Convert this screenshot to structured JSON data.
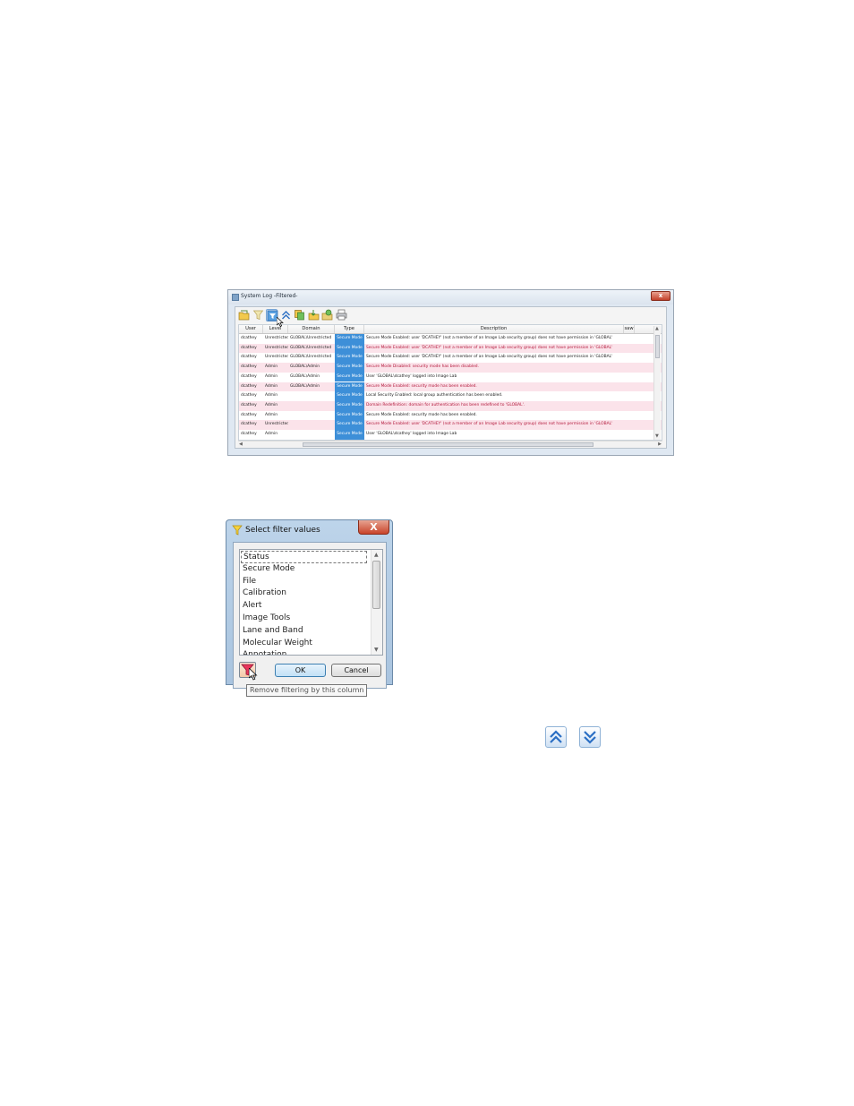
{
  "system_log": {
    "title": "System Log -Filtered-",
    "close_label": "x",
    "toolbar": [
      {
        "icon": "open-folder-icon"
      },
      {
        "icon": "filter-icon"
      },
      {
        "icon": "filtered-view-icon",
        "active": true
      },
      {
        "icon": "collapse-all-icon"
      },
      {
        "icon": "copy-icon"
      },
      {
        "icon": "export-icon"
      },
      {
        "icon": "refresh-icon"
      },
      {
        "icon": "print-icon"
      }
    ],
    "columns": [
      "User",
      "Level",
      "Domain",
      "Type",
      "Description",
      "saw"
    ],
    "rows": [
      {
        "user": "dcathey",
        "level": "Unrestricted",
        "domain": "GLOBAL\\Unrestricted",
        "type": "Secure Mode",
        "description": "Secure Mode Enabled: user 'DCATHEY' (not a member of an Image Lab security group) does not have permission in 'GLOBAL'",
        "pink": false,
        "red": false
      },
      {
        "user": "dcathey",
        "level": "Unrestricted",
        "domain": "GLOBAL\\Unrestricted",
        "type": "Secure Mode",
        "description": "Secure Mode Enabled: user 'DCATHEY' (not a member of an Image Lab security group) does not have permission in 'GLOBAL'",
        "pink": true,
        "red": true
      },
      {
        "user": "dcathey",
        "level": "Unrestricted",
        "domain": "GLOBAL\\Unrestricted",
        "type": "Secure Mode",
        "description": "Secure Mode Enabled: user 'DCATHEY' (not a member of an Image Lab security group) does not have permission in 'GLOBAL'",
        "pink": false,
        "red": false
      },
      {
        "user": "dcathey",
        "level": "Admin",
        "domain": "GLOBAL\\Admin",
        "type": "Secure Mode",
        "description": "Secure Mode Disabled: security mode has been disabled.",
        "pink": true,
        "red": true
      },
      {
        "user": "dcathey",
        "level": "Admin",
        "domain": "GLOBAL\\Admin",
        "type": "Secure Mode",
        "description": "User 'GLOBAL\\dcathey' logged into Image Lab",
        "pink": false,
        "red": false
      },
      {
        "user": "dcathey",
        "level": "Admin",
        "domain": "GLOBAL\\Admin",
        "type": "Secure Mode",
        "description": "Secure Mode Enabled: security mode has been enabled.",
        "pink": true,
        "red": true
      },
      {
        "user": "dcathey",
        "level": "Admin",
        "domain": "",
        "type": "Secure Mode",
        "description": "Local Security Enabled: local group authentication has been enabled.",
        "pink": false,
        "red": false
      },
      {
        "user": "dcathey",
        "level": "Admin",
        "domain": "",
        "type": "Secure Mode",
        "description": "Domain Redefinition: domain for authentication has been redefined to 'GLOBAL'.",
        "pink": true,
        "red": true
      },
      {
        "user": "dcathey",
        "level": "Admin",
        "domain": "",
        "type": "Secure Mode",
        "description": "Secure Mode Enabled: security mode has been enabled.",
        "pink": false,
        "red": false
      },
      {
        "user": "dcathey",
        "level": "Unrestricted",
        "domain": "",
        "type": "Secure Mode",
        "description": "Secure Mode Enabled: user 'DCATHEY' (not a member of an Image Lab security group) does not have permission in 'GLOBAL'",
        "pink": true,
        "red": true
      },
      {
        "user": "dcathey",
        "level": "Admin",
        "domain": "",
        "type": "Secure Mode",
        "description": "User 'GLOBAL\\dcathey' logged into Image Lab",
        "pink": false,
        "red": false
      }
    ]
  },
  "filter_dialog": {
    "title": "Select filter values",
    "close_label": "X",
    "options": [
      "Status",
      "Secure Mode",
      "File",
      "Calibration",
      "Alert",
      "Image Tools",
      "Lane and Band",
      "Molecular Weight",
      "Annotation"
    ],
    "selected_index": 0,
    "ok_label": "OK",
    "cancel_label": "Cancel",
    "tooltip": "Remove filtering by this column"
  },
  "icons": {
    "collapse_all": "collapse-all-icon",
    "expand_all": "expand-all-icon"
  }
}
